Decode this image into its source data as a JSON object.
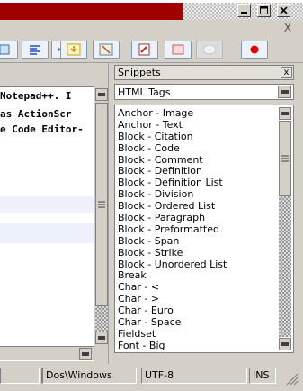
{
  "editor": {
    "lines": [
      "Notepad++. I",
      "as ActionScr",
      "e Code Editor-"
    ]
  },
  "snippets": {
    "title": "Snippets",
    "close_glyph": "x",
    "category_selected": "HTML Tags",
    "items": [
      "Anchor - Image",
      "Anchor - Text",
      "Block - Citation",
      "Block - Code",
      "Block - Comment",
      "Block - Definition",
      "Block - Definition List",
      "Block - Division",
      "Block - Ordered List",
      "Block - Paragraph",
      "Block - Preformatted",
      "Block - Span",
      "Block - Strike",
      "Block - Unordered List",
      "Break",
      "Char - <",
      "Char - >",
      "Char - Euro",
      "Char - Space",
      "Fieldset",
      "Font - Big"
    ]
  },
  "statusbar": {
    "eol": "Dos\\Windows",
    "encoding": "UTF-8",
    "mode": "INS"
  },
  "menu": {
    "close_glyph": "X"
  },
  "colors": {
    "title_red": "#a10000",
    "accent_blue": "#7f9db9"
  }
}
